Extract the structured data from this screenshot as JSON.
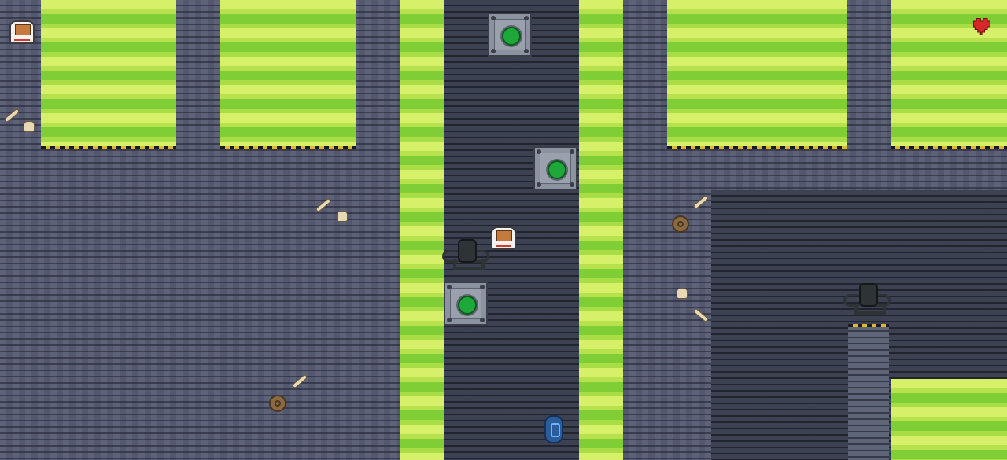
{
  "game": {
    "title": "",
    "hud": {
      "lives_icon": "heart-icon",
      "lives": 1,
      "player_portrait_icon": "astronaut-icon"
    },
    "colors": {
      "floor": "#565c72",
      "dark_floor": "#3d4252",
      "acid": "#8fd83e",
      "hazard_stripe": "#e0b92a",
      "heart": "#d62828"
    },
    "entities": {
      "player": "astronaut-icon",
      "enemy": "alien-spider-icon",
      "crate": "reactor-crate-icon",
      "pickup": "shield-pickup-icon"
    }
  }
}
